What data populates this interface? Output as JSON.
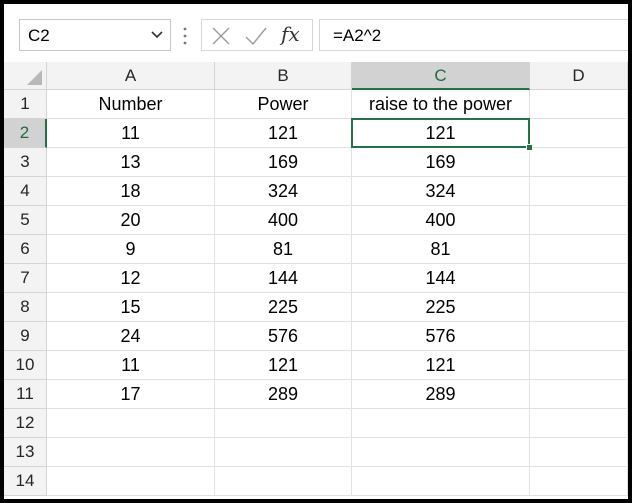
{
  "name_box": {
    "value": "C2"
  },
  "formula_bar": {
    "cancel_icon": "x-icon",
    "enter_icon": "check-icon",
    "fx_label": "fx",
    "formula": "=A2^2"
  },
  "columns": [
    "A",
    "B",
    "C",
    "D"
  ],
  "rows": [
    "1",
    "2",
    "3",
    "4",
    "5",
    "6",
    "7",
    "8",
    "9",
    "10",
    "11",
    "12",
    "13",
    "14"
  ],
  "active_cell": {
    "column": "C",
    "row": "2"
  },
  "cells": [
    [
      "Number",
      "Power",
      "raise to the power",
      ""
    ],
    [
      "11",
      "121",
      "121",
      ""
    ],
    [
      "13",
      "169",
      "169",
      ""
    ],
    [
      "18",
      "324",
      "324",
      ""
    ],
    [
      "20",
      "400",
      "400",
      ""
    ],
    [
      "9",
      "81",
      "81",
      ""
    ],
    [
      "12",
      "144",
      "144",
      ""
    ],
    [
      "15",
      "225",
      "225",
      ""
    ],
    [
      "24",
      "576",
      "576",
      ""
    ],
    [
      "11",
      "121",
      "121",
      ""
    ],
    [
      "17",
      "289",
      "289",
      ""
    ],
    [
      "",
      "",
      "",
      ""
    ],
    [
      "",
      "",
      "",
      ""
    ],
    [
      "",
      "",
      "",
      ""
    ]
  ],
  "colors": {
    "accent": "#217346",
    "header_bg": "#f3f3f3",
    "selected_header_bg": "#d2d2d2",
    "gridline": "#e1e1e1"
  }
}
